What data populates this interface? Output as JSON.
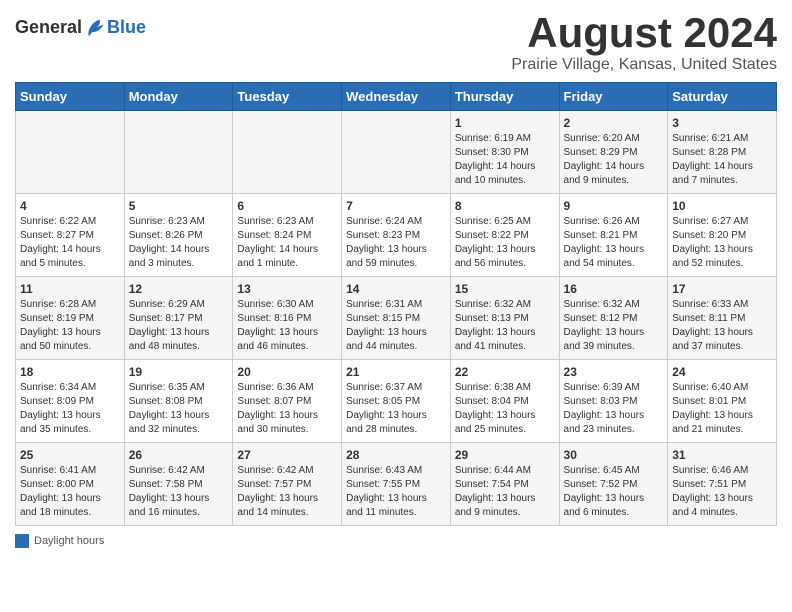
{
  "header": {
    "logo_general": "General",
    "logo_blue": "Blue",
    "month_title": "August 2024",
    "location": "Prairie Village, Kansas, United States"
  },
  "weekdays": [
    "Sunday",
    "Monday",
    "Tuesday",
    "Wednesday",
    "Thursday",
    "Friday",
    "Saturday"
  ],
  "weeks": [
    [
      {
        "day": "",
        "info": ""
      },
      {
        "day": "",
        "info": ""
      },
      {
        "day": "",
        "info": ""
      },
      {
        "day": "",
        "info": ""
      },
      {
        "day": "1",
        "info": "Sunrise: 6:19 AM\nSunset: 8:30 PM\nDaylight: 14 hours and 10 minutes."
      },
      {
        "day": "2",
        "info": "Sunrise: 6:20 AM\nSunset: 8:29 PM\nDaylight: 14 hours and 9 minutes."
      },
      {
        "day": "3",
        "info": "Sunrise: 6:21 AM\nSunset: 8:28 PM\nDaylight: 14 hours and 7 minutes."
      }
    ],
    [
      {
        "day": "4",
        "info": "Sunrise: 6:22 AM\nSunset: 8:27 PM\nDaylight: 14 hours and 5 minutes."
      },
      {
        "day": "5",
        "info": "Sunrise: 6:23 AM\nSunset: 8:26 PM\nDaylight: 14 hours and 3 minutes."
      },
      {
        "day": "6",
        "info": "Sunrise: 6:23 AM\nSunset: 8:24 PM\nDaylight: 14 hours and 1 minute."
      },
      {
        "day": "7",
        "info": "Sunrise: 6:24 AM\nSunset: 8:23 PM\nDaylight: 13 hours and 59 minutes."
      },
      {
        "day": "8",
        "info": "Sunrise: 6:25 AM\nSunset: 8:22 PM\nDaylight: 13 hours and 56 minutes."
      },
      {
        "day": "9",
        "info": "Sunrise: 6:26 AM\nSunset: 8:21 PM\nDaylight: 13 hours and 54 minutes."
      },
      {
        "day": "10",
        "info": "Sunrise: 6:27 AM\nSunset: 8:20 PM\nDaylight: 13 hours and 52 minutes."
      }
    ],
    [
      {
        "day": "11",
        "info": "Sunrise: 6:28 AM\nSunset: 8:19 PM\nDaylight: 13 hours and 50 minutes."
      },
      {
        "day": "12",
        "info": "Sunrise: 6:29 AM\nSunset: 8:17 PM\nDaylight: 13 hours and 48 minutes."
      },
      {
        "day": "13",
        "info": "Sunrise: 6:30 AM\nSunset: 8:16 PM\nDaylight: 13 hours and 46 minutes."
      },
      {
        "day": "14",
        "info": "Sunrise: 6:31 AM\nSunset: 8:15 PM\nDaylight: 13 hours and 44 minutes."
      },
      {
        "day": "15",
        "info": "Sunrise: 6:32 AM\nSunset: 8:13 PM\nDaylight: 13 hours and 41 minutes."
      },
      {
        "day": "16",
        "info": "Sunrise: 6:32 AM\nSunset: 8:12 PM\nDaylight: 13 hours and 39 minutes."
      },
      {
        "day": "17",
        "info": "Sunrise: 6:33 AM\nSunset: 8:11 PM\nDaylight: 13 hours and 37 minutes."
      }
    ],
    [
      {
        "day": "18",
        "info": "Sunrise: 6:34 AM\nSunset: 8:09 PM\nDaylight: 13 hours and 35 minutes."
      },
      {
        "day": "19",
        "info": "Sunrise: 6:35 AM\nSunset: 8:08 PM\nDaylight: 13 hours and 32 minutes."
      },
      {
        "day": "20",
        "info": "Sunrise: 6:36 AM\nSunset: 8:07 PM\nDaylight: 13 hours and 30 minutes."
      },
      {
        "day": "21",
        "info": "Sunrise: 6:37 AM\nSunset: 8:05 PM\nDaylight: 13 hours and 28 minutes."
      },
      {
        "day": "22",
        "info": "Sunrise: 6:38 AM\nSunset: 8:04 PM\nDaylight: 13 hours and 25 minutes."
      },
      {
        "day": "23",
        "info": "Sunrise: 6:39 AM\nSunset: 8:03 PM\nDaylight: 13 hours and 23 minutes."
      },
      {
        "day": "24",
        "info": "Sunrise: 6:40 AM\nSunset: 8:01 PM\nDaylight: 13 hours and 21 minutes."
      }
    ],
    [
      {
        "day": "25",
        "info": "Sunrise: 6:41 AM\nSunset: 8:00 PM\nDaylight: 13 hours and 18 minutes."
      },
      {
        "day": "26",
        "info": "Sunrise: 6:42 AM\nSunset: 7:58 PM\nDaylight: 13 hours and 16 minutes."
      },
      {
        "day": "27",
        "info": "Sunrise: 6:42 AM\nSunset: 7:57 PM\nDaylight: 13 hours and 14 minutes."
      },
      {
        "day": "28",
        "info": "Sunrise: 6:43 AM\nSunset: 7:55 PM\nDaylight: 13 hours and 11 minutes."
      },
      {
        "day": "29",
        "info": "Sunrise: 6:44 AM\nSunset: 7:54 PM\nDaylight: 13 hours and 9 minutes."
      },
      {
        "day": "30",
        "info": "Sunrise: 6:45 AM\nSunset: 7:52 PM\nDaylight: 13 hours and 6 minutes."
      },
      {
        "day": "31",
        "info": "Sunrise: 6:46 AM\nSunset: 7:51 PM\nDaylight: 13 hours and 4 minutes."
      }
    ]
  ],
  "legend": {
    "color_label": "Daylight hours"
  }
}
